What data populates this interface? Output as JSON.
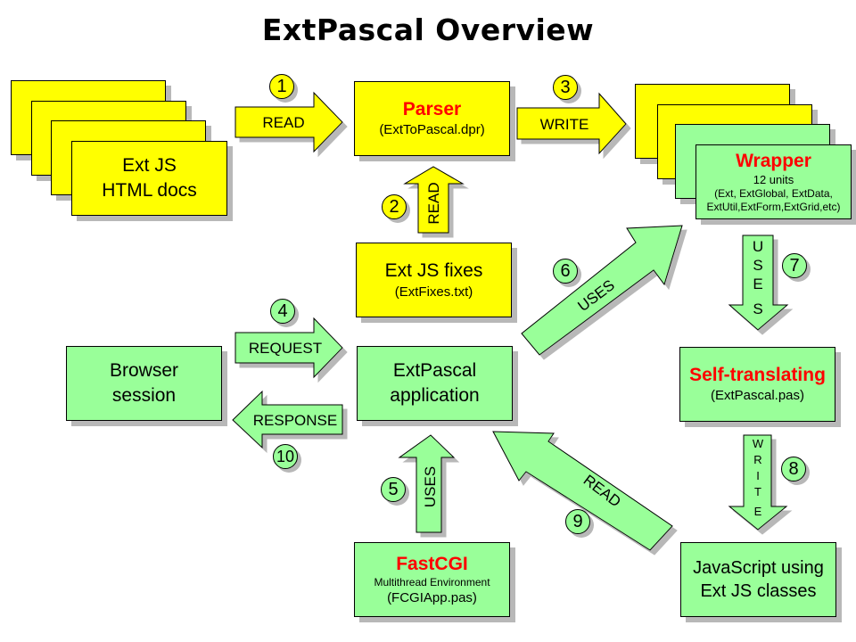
{
  "title": "ExtPascal Overview",
  "colors": {
    "yellow": "#ffff00",
    "green": "#99ff99",
    "accent_red": "#ff0000"
  },
  "nodes": {
    "ext_docs": {
      "line1": "Ext JS",
      "line2": "HTML docs"
    },
    "parser": {
      "title": "Parser",
      "sub": "(ExtToPascal.dpr)"
    },
    "wrapper": {
      "title": "Wrapper",
      "sub": "12 units",
      "detail1": "(Ext, ExtGlobal, ExtData,",
      "detail2": "ExtUtil,ExtForm,ExtGrid,etc)"
    },
    "fixes": {
      "title": "Ext JS fixes",
      "sub": "(ExtFixes.txt)"
    },
    "browser": {
      "line1": "Browser",
      "line2": "session"
    },
    "app": {
      "line1": "ExtPascal",
      "line2": "application"
    },
    "self_translating": {
      "title": "Self-translating",
      "sub": "(ExtPascal.pas)"
    },
    "fastcgi": {
      "title": "FastCGI",
      "sub": "Multithread Environment",
      "detail": "(FCGIApp.pas)"
    },
    "javascript": {
      "line1": "JavaScript using",
      "line2": "Ext JS classes"
    }
  },
  "arrows": [
    {
      "step": "1",
      "label": "READ"
    },
    {
      "step": "2",
      "label": "READ"
    },
    {
      "step": "3",
      "label": "WRITE"
    },
    {
      "step": "4",
      "label": "REQUEST"
    },
    {
      "step": "5",
      "label": "USES"
    },
    {
      "step": "6",
      "label": "USES"
    },
    {
      "step": "7",
      "label": "USES"
    },
    {
      "step": "8",
      "label": "WRITE"
    },
    {
      "step": "9",
      "label": "READ"
    },
    {
      "step": "10",
      "label": "RESPONSE"
    }
  ]
}
